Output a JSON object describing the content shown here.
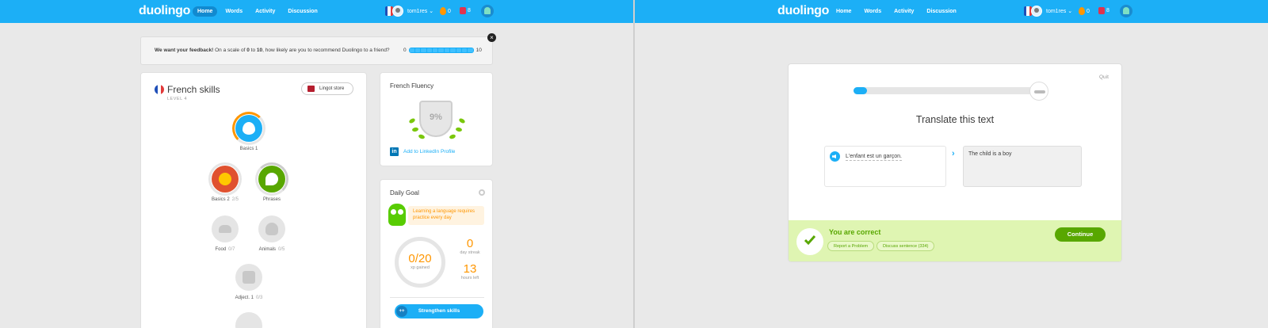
{
  "nav": {
    "logo": "duolingo",
    "items": [
      "Home",
      "Words",
      "Activity",
      "Discussion"
    ],
    "active_item": "Home",
    "username": "tom1res",
    "streak_count": "0",
    "gems_count": "8"
  },
  "feedback": {
    "prompt_bold": "We want your feedback!",
    "prompt_mid": " On a scale of ",
    "prompt_zero": "0",
    "prompt_to": " to ",
    "prompt_ten": "10",
    "prompt_end": ", how likely are you to recommend Duolingo to a friend?",
    "scale_min": "0",
    "scale_max": "10"
  },
  "skills": {
    "title": "French skills",
    "level": "LEVEL 4",
    "lingot_store_label": "Lingot store",
    "items": [
      {
        "name": "Basics 1",
        "progress": ""
      },
      {
        "name": "Basics 2",
        "progress": "2/5"
      },
      {
        "name": "Phrases",
        "progress": ""
      },
      {
        "name": "Food",
        "progress": "0/7"
      },
      {
        "name": "Animals",
        "progress": "0/5"
      },
      {
        "name": "Adject. 1",
        "progress": "0/3"
      }
    ]
  },
  "fluency": {
    "title": "French Fluency",
    "percent": "9%",
    "linkedin_label": "Add to LinkedIn Profile"
  },
  "daily_goal": {
    "title": "Daily Goal",
    "tip": "Learning a language requires practice every day",
    "xp_value": "0/20",
    "xp_label": "xp gained",
    "streak_value": "0",
    "streak_label": "day streak",
    "hours_value": "13",
    "hours_label": "hours left",
    "strengthen_label": "Strengthen skills",
    "strengthen_icon": "++"
  },
  "lesson": {
    "quit_label": "Quit",
    "progress": 0.07,
    "instruction": "Translate this text",
    "prompt_text": "L'enfant est un garçon.",
    "answer_text": "The child is a boy",
    "result_title": "You are correct",
    "report_label": "Report a Problem",
    "discuss_label": "Discuss sentence (334)",
    "continue_label": "Continue"
  },
  "colors": {
    "brand_blue": "#1caff6",
    "correct_green": "#58a700",
    "streak_orange": "#ff9600",
    "gem_red": "#e0344f"
  }
}
